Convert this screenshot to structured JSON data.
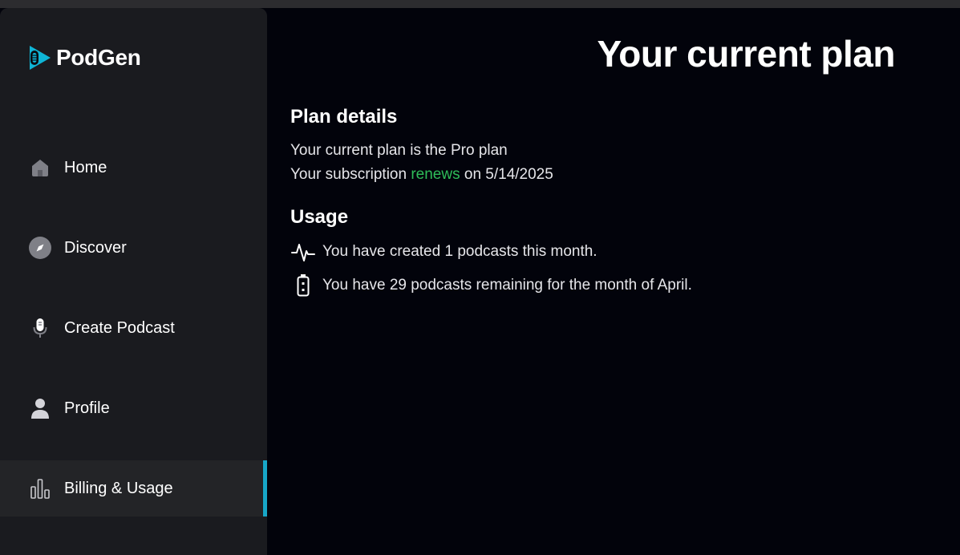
{
  "brand": {
    "name": "PodGen"
  },
  "sidebar": {
    "items": [
      {
        "label": "Home",
        "icon": "home-icon"
      },
      {
        "label": "Discover",
        "icon": "compass-icon"
      },
      {
        "label": "Create Podcast",
        "icon": "microphone-icon"
      },
      {
        "label": "Profile",
        "icon": "user-icon"
      },
      {
        "label": "Billing & Usage",
        "icon": "bar-chart-icon",
        "active": true
      }
    ]
  },
  "main": {
    "title": "Your current plan",
    "plan_details": {
      "heading": "Plan details",
      "plan_line": "Your current plan is the Pro plan",
      "renew_prefix": "Your subscription",
      "renew_word": "renews",
      "renew_suffix": "on 5/14/2025"
    },
    "usage": {
      "heading": "Usage",
      "created_text": "You have created 1 podcasts this month.",
      "remaining_text": "You have 29 podcasts remaining for the month of April."
    }
  },
  "colors": {
    "accent": "#17a7c8",
    "renew_green": "#2ebd59",
    "sidebar_bg": "#1a1b1f",
    "main_bg": "#02030b"
  }
}
